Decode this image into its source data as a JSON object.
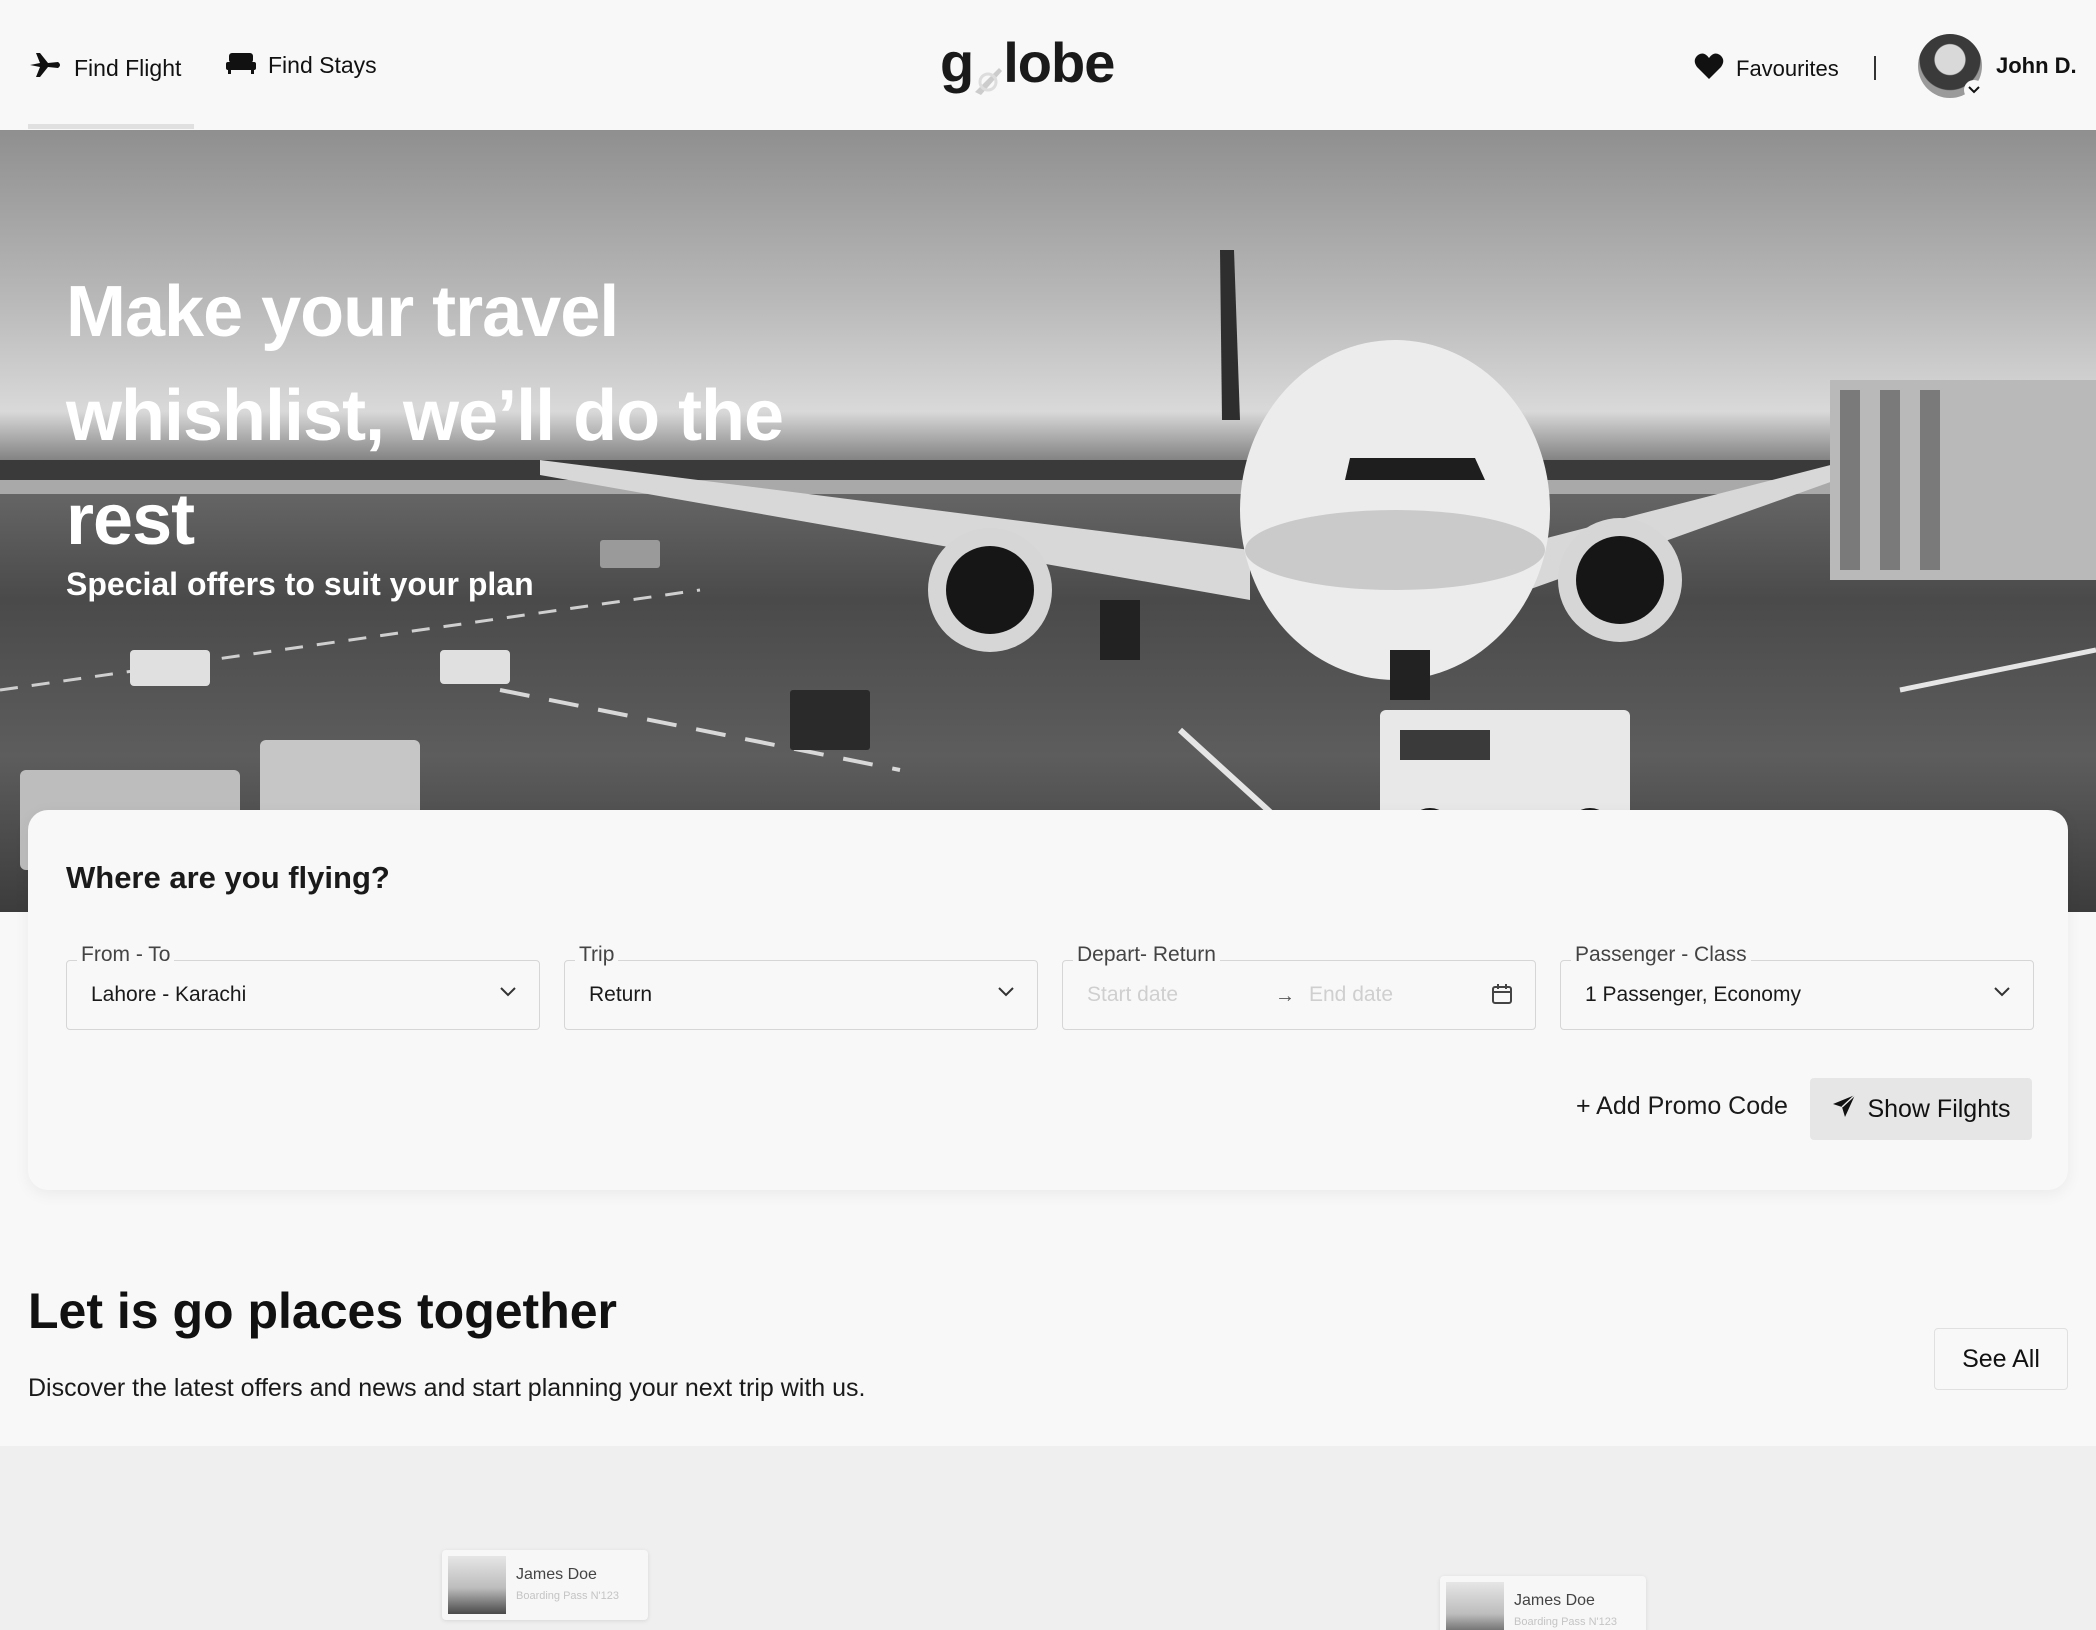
{
  "header": {
    "nav": [
      {
        "label": "Find Flight",
        "icon": "airplane-icon"
      },
      {
        "label": "Find Stays",
        "icon": "bed-icon"
      }
    ],
    "logo": {
      "before": "g",
      "after": "lobe"
    },
    "favourites_label": "Favourites",
    "user_name": "John D."
  },
  "hero": {
    "title": "Make your travel whishlist, we’ll do the rest",
    "subtitle": "Special offers to suit your plan"
  },
  "search": {
    "title": "Where are you flying?",
    "from_to": {
      "label": "From - To",
      "value": "Lahore - Karachi"
    },
    "trip": {
      "label": "Trip",
      "value": "Return"
    },
    "dates": {
      "label": "Depart- Return",
      "start_placeholder": "Start date",
      "end_placeholder": "End date"
    },
    "passenger": {
      "label": "Passenger - Class",
      "value": "1 Passenger, Economy"
    },
    "promo_label": "+ Add Promo Code",
    "show_label": "Show Filghts"
  },
  "places": {
    "title": "Let is go places together",
    "subtitle": "Discover the latest offers and news and start planning your next trip with us.",
    "see_all_label": "See All"
  },
  "boarding_cards": [
    {
      "name": "James Doe",
      "sub": "Boarding Pass N'123"
    },
    {
      "name": "James Doe",
      "sub": "Boarding Pass N'123"
    }
  ],
  "colors": {
    "background": "#f8f8f8",
    "button": "#e6e6e6",
    "text": "#111111"
  }
}
